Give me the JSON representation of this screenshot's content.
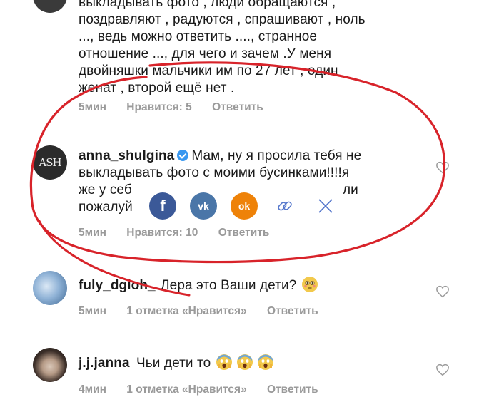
{
  "comments": [
    {
      "text_lines": [
        "выкладывать фото , люди обращаются ,",
        "поздравляют , радуются , спрашивают , ноль",
        "..., ведь можно ответить ...., странное",
        "отношение ..., для чего и зачем .У меня",
        "двойняшки мальчики им по 27 лет , один",
        "женат , второй ещё нет ."
      ],
      "time": "5мин",
      "likes": "Нравится: 5",
      "reply": "Ответить"
    },
    {
      "username": "anna_shulgina",
      "avatar_text": "ASH",
      "verified": true,
      "text_lines": [
        "Мам, ну я просила тебя не",
        "выкладывать фото с моими бусинками!!!!я",
        "же у себ",
        "пожалуй"
      ],
      "text_tail": "ли",
      "time": "5мин",
      "likes": "Нравится: 10",
      "reply": "Ответить"
    },
    {
      "username": "fuly_dgioh_",
      "text": "Лера это Ваши дети?",
      "emoji": "flushed-face",
      "time": "5мин",
      "likes": "1 отметка «Нравится»",
      "reply": "Ответить"
    },
    {
      "username": "j.j.janna",
      "text": "Чьи дети то",
      "emoji": [
        "screaming-face",
        "screaming-face",
        "screaming-face"
      ],
      "time": "4мин",
      "likes": "1 отметка «Нравится»",
      "reply": "Ответить"
    }
  ],
  "share": {
    "facebook": "f",
    "vk": "vk",
    "odnoklassniki": "ok",
    "colors": {
      "facebook": "#3b5998",
      "vk": "#4a76a8",
      "odnoklassniki": "#ee8208",
      "link": "#5577cc",
      "close": "#5577cc"
    }
  },
  "annotation_color": "#d8232a"
}
